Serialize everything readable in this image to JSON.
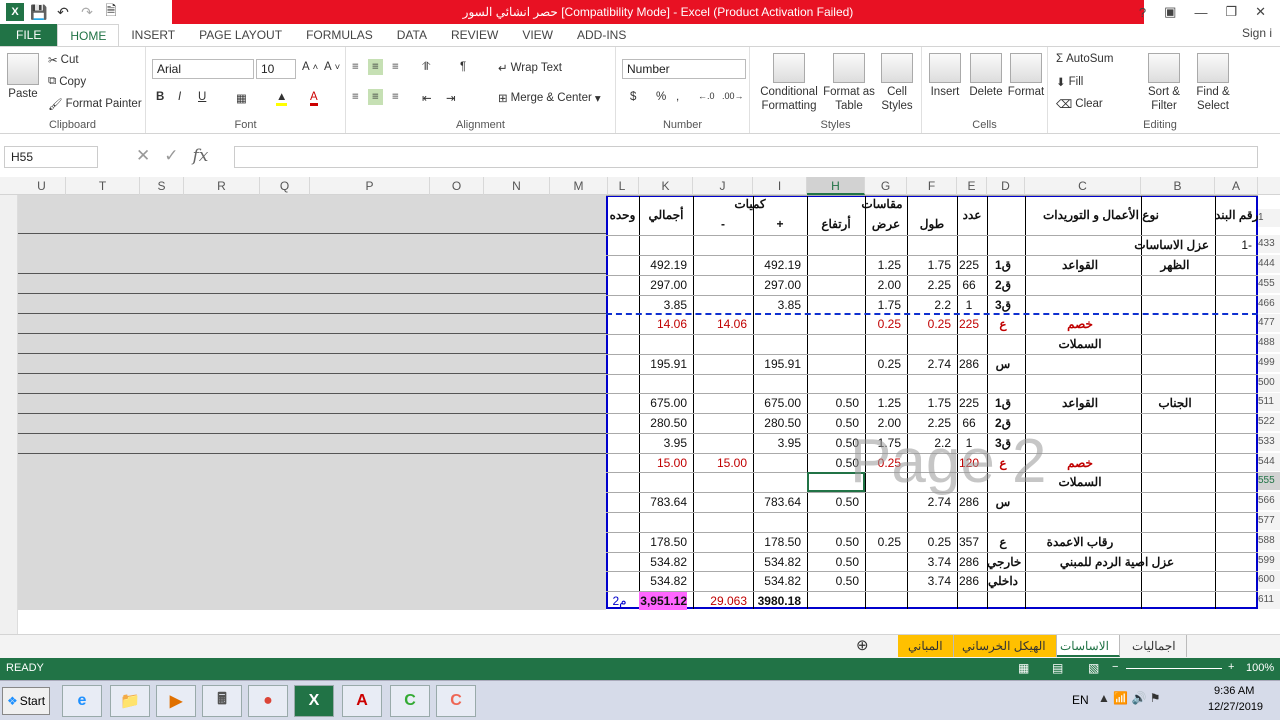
{
  "window": {
    "title": "حصر انشائي السور  [Compatibility Mode] -  Excel (Product Activation Failed)"
  },
  "tabs": [
    "FILE",
    "HOME",
    "INSERT",
    "PAGE LAYOUT",
    "FORMULAS",
    "DATA",
    "REVIEW",
    "VIEW",
    "ADD-INS"
  ],
  "signin": "Sign i",
  "clipboard": {
    "paste": "Paste",
    "cut": "Cut",
    "copy": "Copy",
    "painter": "Format Painter",
    "label": "Clipboard"
  },
  "font": {
    "name": "Arial",
    "size": "10",
    "label": "Font",
    "bold": "B",
    "italic": "I",
    "underline": "U"
  },
  "alignment": {
    "wrap": "Wrap Text",
    "merge": "Merge & Center",
    "label": "Alignment"
  },
  "number": {
    "format": "Number",
    "currency": "$",
    "percent": "%",
    "comma": ",",
    "label": "Number"
  },
  "styles": {
    "cond": "Conditional Formatting",
    "table": "Format as Table",
    "cell": "Cell Styles",
    "label": "Styles"
  },
  "cells": {
    "insert": "Insert",
    "delete": "Delete",
    "format": "Format",
    "label": "Cells"
  },
  "editing": {
    "autosum": "AutoSum",
    "fill": "Fill",
    "clear": "Clear",
    "sort": "Sort & Filter",
    "find": "Find & Select",
    "label": "Editing"
  },
  "namebox": "H55",
  "fx": "fx",
  "columns": [
    "U",
    "T",
    "S",
    "R",
    "Q",
    "P",
    "O",
    "N",
    "M",
    "L",
    "K",
    "J",
    "I",
    "H",
    "G",
    "F",
    "E",
    "D",
    "C",
    "B",
    "A"
  ],
  "headers": {
    "wahda": "وحده",
    "ijmali": "أجمالي",
    "kamiyat": "كميات",
    "minus": "-",
    "plus": "+",
    "maqasat": "مقاسات",
    "irtifa": "أرتفاع",
    "ard": "عرض",
    "tol": "طول",
    "adad": "عدد",
    "naw": "نوع الأعمال و التوريدات",
    "raqm": "رقم البند"
  },
  "rows": [
    {
      "hdr": "1",
      "A": "",
      "B": "",
      "C": "",
      "D": "",
      "E": "",
      "F": "",
      "G": "",
      "H": "",
      "I": "",
      "J": "",
      "K": "",
      "L": ""
    },
    {
      "hdr": "433",
      "A": "1-",
      "B": "عزل الاساسات"
    },
    {
      "hdr": "444",
      "B": "الظهر",
      "C": "القواعد",
      "D": "ق1",
      "E": "225",
      "F": "1.75",
      "G": "1.25",
      "H": "",
      "I": "492.19",
      "J": "",
      "K": "492.19"
    },
    {
      "hdr": "455",
      "D": "ق2",
      "E": "66",
      "F": "2.25",
      "G": "2.00",
      "I": "297.00",
      "K": "297.00"
    },
    {
      "hdr": "466",
      "D": "ق3",
      "E": "1",
      "F": "2.2",
      "G": "1.75",
      "I": "3.85",
      "K": "3.85"
    },
    {
      "hdr": "477",
      "C": "خصم",
      "D": "ع",
      "E": "225",
      "F": "0.25",
      "G": "0.25",
      "J": "14.06",
      "K": "14.06",
      "red": true
    },
    {
      "hdr": "488",
      "C": "السملات"
    },
    {
      "hdr": "499",
      "D": "س",
      "E": "286",
      "F": "2.74",
      "G": "0.25",
      "I": "195.91",
      "K": "195.91"
    },
    {
      "hdr": "500"
    },
    {
      "hdr": "511",
      "B": "الجناب",
      "C": "القواعد",
      "D": "ق1",
      "E": "225",
      "F": "1.75",
      "G": "1.25",
      "H": "0.50",
      "I": "675.00",
      "K": "675.00"
    },
    {
      "hdr": "522",
      "D": "ق2",
      "E": "66",
      "F": "2.25",
      "G": "2.00",
      "H": "0.50",
      "I": "280.50",
      "K": "280.50"
    },
    {
      "hdr": "533",
      "D": "ق3",
      "E": "1",
      "F": "2.2",
      "G": "1.75",
      "H": "0.50",
      "I": "3.95",
      "K": "3.95"
    },
    {
      "hdr": "544",
      "C": "خصم",
      "D": "ع",
      "E": "120",
      "F": "",
      "G": "0.25",
      "H": "0.50",
      "J": "15.00",
      "K": "15.00",
      "red": true
    },
    {
      "hdr": "555",
      "C": "السملات"
    },
    {
      "hdr": "566",
      "D": "س",
      "E": "286",
      "F": "2.74",
      "H": "0.50",
      "I": "783.64",
      "K": "783.64"
    },
    {
      "hdr": "577"
    },
    {
      "hdr": "588",
      "C": "رقاب الاعمدة",
      "D": "ع",
      "E": "357",
      "F": "0.25",
      "G": "0.25",
      "H": "0.50",
      "I": "178.50",
      "K": "178.50"
    },
    {
      "hdr": "599",
      "C": "عزل اصية الردم للمبني",
      "D": "خارجي",
      "E": "286",
      "F": "3.74",
      "H": "0.50",
      "I": "534.82",
      "K": "534.82"
    },
    {
      "hdr": "600",
      "D": "داخلي",
      "E": "286",
      "F": "3.74",
      "H": "0.50",
      "I": "534.82",
      "K": "534.82"
    },
    {
      "hdr": "611",
      "I": "3980.18",
      "J": "29.063",
      "K": "3,951.12",
      "L": "م2"
    }
  ],
  "watermark": "Page 2",
  "sheets": [
    "اجماليات",
    "الاساسات",
    "الهيكل الخرساني",
    "المباني"
  ],
  "status": {
    "ready": "READY",
    "zoom": "100%"
  },
  "taskbar": {
    "start": "Start",
    "lang": "EN",
    "time": "9:36 AM",
    "date": "12/27/2019"
  }
}
